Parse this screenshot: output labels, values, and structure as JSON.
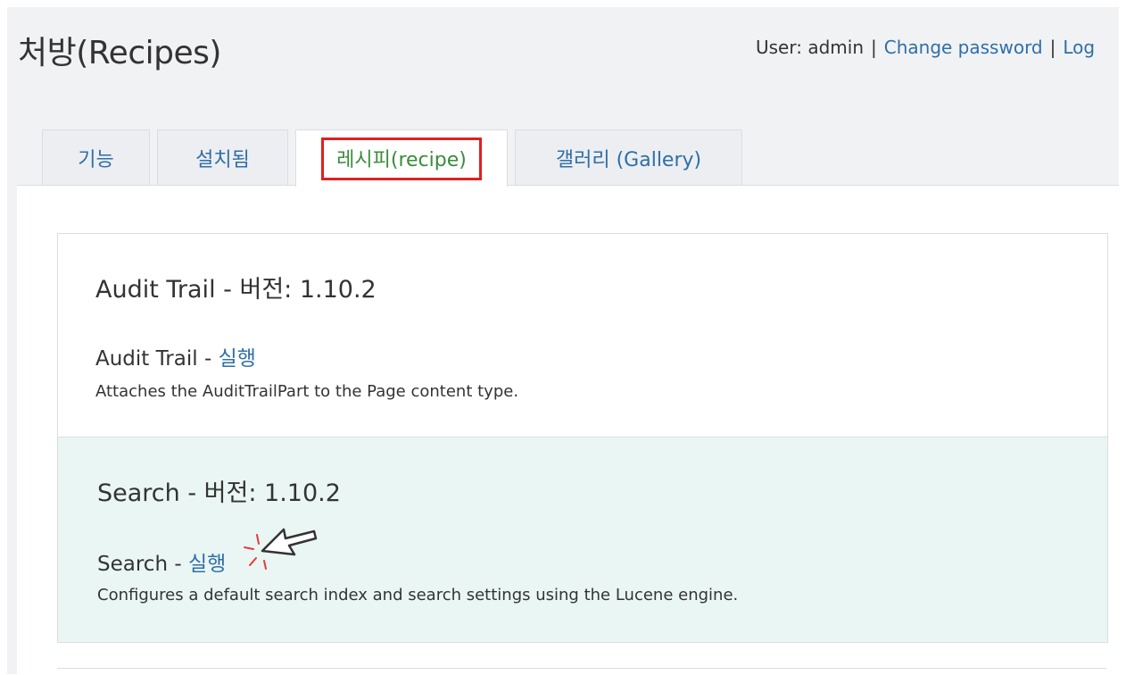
{
  "header": {
    "title": "처방(Recipes)",
    "user_label": "User: admin",
    "change_password": "Change password",
    "separator": "|",
    "logout": "Log"
  },
  "tabs": [
    {
      "label": "기능",
      "active": false
    },
    {
      "label": "설치됨",
      "active": false
    },
    {
      "label": "레시피(recipe)",
      "active": true
    },
    {
      "label": "갤러리 (Gallery)",
      "active": false
    }
  ],
  "recipes": [
    {
      "heading": "Audit Trail - 버전: 1.10.2",
      "name": "Audit Trail - ",
      "run_label": "실행",
      "description": "Attaches the AuditTrailPart to the Page content type."
    },
    {
      "heading": "Search - 버전: 1.10.2",
      "name": "Search - ",
      "run_label": "실행",
      "description": "Configures a default search index and search settings using the Lucene engine."
    }
  ],
  "colors": {
    "link": "#2e6fa7",
    "highlight_border": "#e02020",
    "active_tab_text": "#3a8c3a",
    "selected_row_bg": "#eaf6f3"
  },
  "icons": {
    "pointer": "click-pointer-icon"
  }
}
